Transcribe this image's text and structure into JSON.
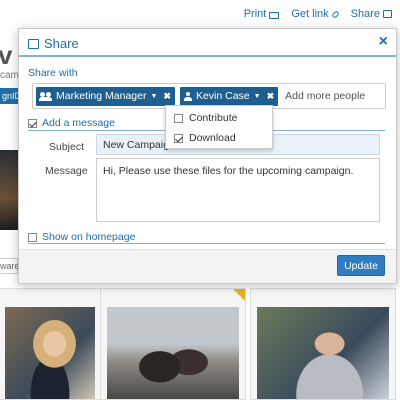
{
  "background": {
    "title_fragment": "v C",
    "small_fragment": "cam",
    "chip_fragment": "gnID",
    "select_fragment": "ware",
    "top_actions": {
      "print": "Print",
      "get_link": "Get link",
      "share": "Share"
    }
  },
  "modal": {
    "title": "Share",
    "close_glyph": "×",
    "share_with_label": "Share with",
    "recipients": [
      {
        "label": "Marketing Manager",
        "kind": "group"
      },
      {
        "label": "Kevin Case",
        "kind": "user"
      }
    ],
    "add_more_placeholder": "Add more people",
    "permissions_dropdown": {
      "options": [
        {
          "label": "Contribute",
          "checked": false
        },
        {
          "label": "Download",
          "checked": true
        }
      ]
    },
    "add_message_toggle": {
      "label": "Add a message",
      "checked": true
    },
    "subject": {
      "label": "Subject",
      "value": "New Campaign"
    },
    "message": {
      "label": "Message",
      "value": "Hi, Please use these files for the upcoming campaign."
    },
    "show_on_homepage_toggle": {
      "label": "Show on homepage",
      "checked": false
    },
    "update_label": "Update"
  },
  "colors": {
    "accent": "#1e6fa8",
    "tag_bg": "#1f5f8f",
    "button": "#2f7dc0"
  }
}
